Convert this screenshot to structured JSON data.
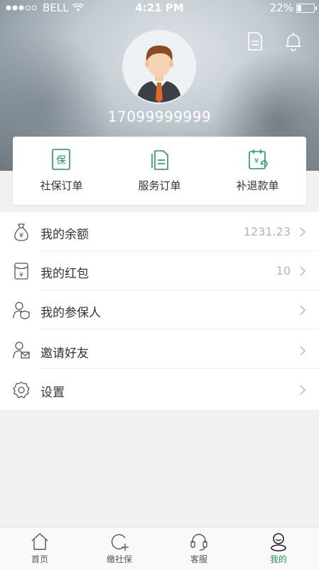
{
  "status_bar": {
    "carrier": "BELL",
    "time": "4:21 PM",
    "battery": "22%",
    "battery_level": 0.22,
    "signal_dots_filled": 3,
    "signal_dots_total": 5
  },
  "header": {
    "phone": "17099999999",
    "icons": [
      "document-icon",
      "bell-icon"
    ]
  },
  "orders": [
    {
      "label": "社保订单",
      "icon": "shebao-icon"
    },
    {
      "label": "服务订单",
      "icon": "service-order-icon"
    },
    {
      "label": "补退款单",
      "icon": "refund-icon"
    }
  ],
  "menu": [
    {
      "label": "我的余额",
      "value": "1231.23",
      "icon": "money-bag-icon"
    },
    {
      "label": "我的红包",
      "value": "10",
      "icon": "red-packet-icon"
    },
    {
      "label": "我的参保人",
      "value": "",
      "icon": "insured-person-icon"
    },
    {
      "label": "邀请好友",
      "value": "",
      "icon": "invite-friend-icon"
    },
    {
      "label": "设置",
      "value": "",
      "icon": "settings-icon"
    }
  ],
  "tabs": [
    {
      "label": "首页",
      "icon": "home-icon",
      "active": false
    },
    {
      "label": "缴社保",
      "icon": "pay-insurance-icon",
      "active": false
    },
    {
      "label": "客服",
      "icon": "headset-icon",
      "active": false
    },
    {
      "label": "我的",
      "icon": "profile-icon",
      "active": true
    }
  ],
  "colors": {
    "accent": "#1f9d55",
    "text": "#333333",
    "muted": "#b3b3b3",
    "background": "#f1f1f1"
  }
}
